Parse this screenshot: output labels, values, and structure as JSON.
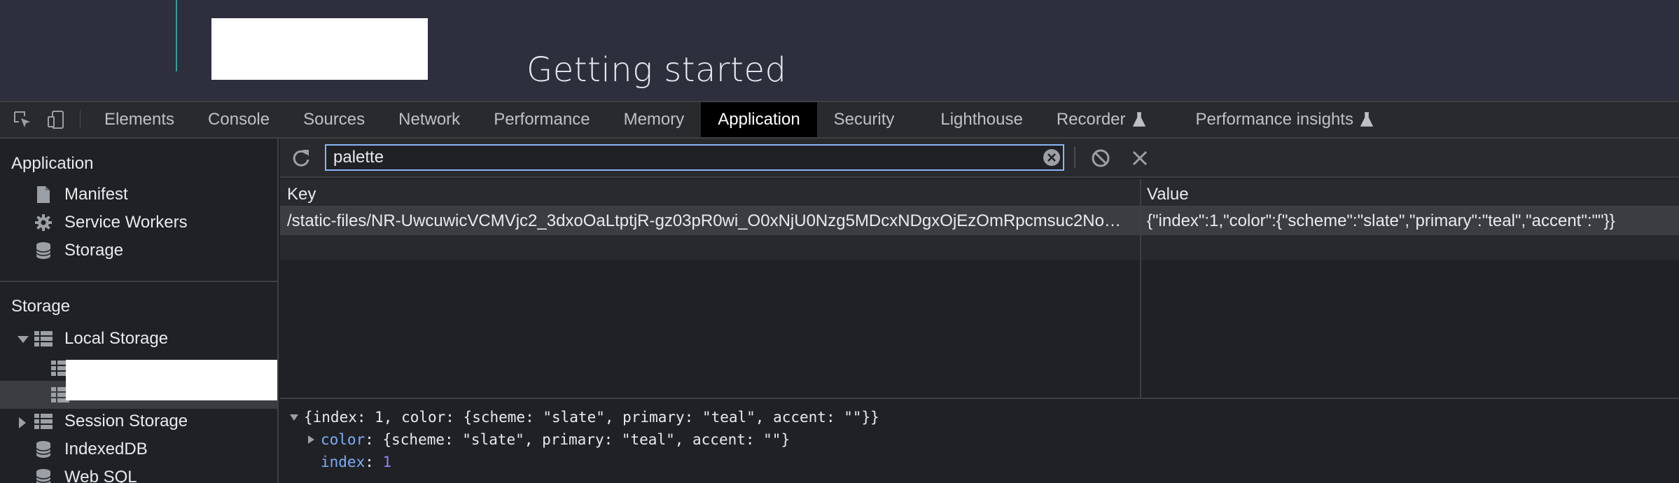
{
  "page": {
    "heading": "Getting started"
  },
  "devtools": {
    "tabs": [
      {
        "label": "Elements"
      },
      {
        "label": "Console"
      },
      {
        "label": "Sources"
      },
      {
        "label": "Network"
      },
      {
        "label": "Performance"
      },
      {
        "label": "Memory"
      },
      {
        "label": "Application",
        "active": true
      },
      {
        "label": "Security"
      },
      {
        "label": "Lighthouse"
      },
      {
        "label": "Recorder",
        "experimental": true
      },
      {
        "label": "Performance insights",
        "experimental": true
      }
    ]
  },
  "sidebar": {
    "application_header": "Application",
    "application_items": [
      {
        "label": "Manifest",
        "icon": "file-icon"
      },
      {
        "label": "Service Workers",
        "icon": "gear-icon"
      },
      {
        "label": "Storage",
        "icon": "database-icon"
      }
    ],
    "storage_header": "Storage",
    "storage_items": [
      {
        "label": "Local Storage",
        "icon": "grid-icon",
        "expanded": true
      },
      {
        "label": "Session Storage",
        "icon": "grid-icon",
        "expanded": false
      },
      {
        "label": "IndexedDB",
        "icon": "database-icon"
      },
      {
        "label": "Web SQL",
        "icon": "database-icon"
      }
    ]
  },
  "toolbar": {
    "filter_value": "palette"
  },
  "table": {
    "headers": {
      "key": "Key",
      "value": "Value"
    },
    "rows": [
      {
        "key": "/static-files/NR-UwcuwicVCMVjc2_3dxoOaLtptjR-gz03pR0wi_O0xNjU0Nzg5MDcxNDgxOjEzOmRpcmsuc2No…",
        "value": "{\"index\":1,\"color\":{\"scheme\":\"slate\",\"primary\":\"teal\",\"accent\":\"\"}}"
      }
    ]
  },
  "preview": {
    "root": "{index: 1, color: {scheme: \"slate\", primary: \"teal\", accent: \"\"}}",
    "color_key": "color",
    "color_value": ": {scheme: \"slate\", primary: \"teal\", accent: \"\"}",
    "index_key": "index",
    "index_sep": ": ",
    "index_value": "1"
  },
  "colors": {
    "accent": "#8ab4f8",
    "active_tab_bg": "#000000",
    "top_rule": "#2fa39a"
  }
}
